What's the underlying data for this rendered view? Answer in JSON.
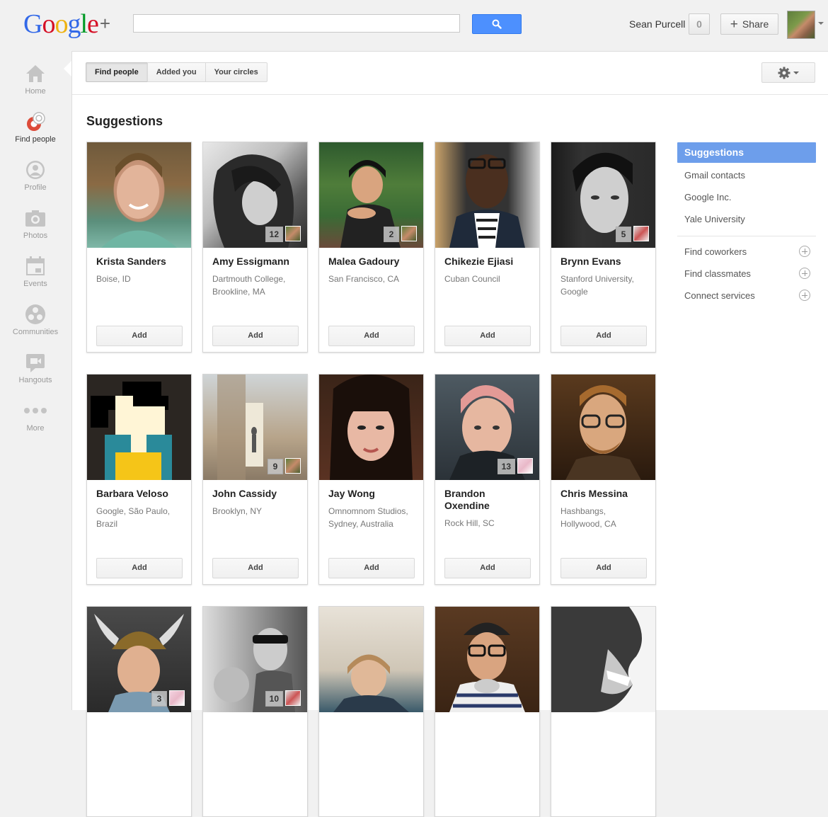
{
  "header": {
    "logo_letters": [
      "G",
      "o",
      "o",
      "g",
      "l",
      "e"
    ],
    "logo_plus": "+",
    "search_value": "",
    "username": "Sean Purcell",
    "notification_count": "0",
    "share_label": "Share"
  },
  "leftnav": {
    "items": [
      {
        "label": "Home",
        "icon": "home-icon"
      },
      {
        "label": "Find people",
        "icon": "find-people-icon",
        "active": true
      },
      {
        "label": "Profile",
        "icon": "profile-icon"
      },
      {
        "label": "Photos",
        "icon": "camera-icon"
      },
      {
        "label": "Events",
        "icon": "calendar-icon"
      },
      {
        "label": "Communities",
        "icon": "communities-icon"
      },
      {
        "label": "Hangouts",
        "icon": "hangouts-icon"
      },
      {
        "label": "More",
        "icon": "more-dots-icon"
      }
    ]
  },
  "tabs": [
    {
      "label": "Find people",
      "selected": true
    },
    {
      "label": "Added you"
    },
    {
      "label": "Your circles"
    }
  ],
  "main": {
    "title": "Suggestions",
    "add_label": "Add",
    "cards": [
      {
        "name": "Krista Sanders",
        "meta": [
          "Boise, ID"
        ],
        "badge": ""
      },
      {
        "name": "Amy Essigmann",
        "meta": [
          "Dartmouth College,",
          "Brookline, MA"
        ],
        "badge": "12"
      },
      {
        "name": "Malea Gadoury",
        "meta": [
          "San Francisco, CA"
        ],
        "badge": "2"
      },
      {
        "name": "Chikezie Ejiasi",
        "meta": [
          "Cuban Council"
        ],
        "badge": ""
      },
      {
        "name": "Brynn Evans",
        "meta": [
          "Stanford University,",
          "Google"
        ],
        "badge": "5"
      },
      {
        "name": "Barbara Veloso",
        "meta": [
          "Google, São Paulo,",
          "Brazil"
        ],
        "badge": ""
      },
      {
        "name": "John Cassidy",
        "meta": [
          "Brooklyn, NY"
        ],
        "badge": "9"
      },
      {
        "name": "Jay Wong",
        "meta": [
          "Omnomnom Studios,",
          "Sydney, Australia"
        ],
        "badge": ""
      },
      {
        "name": "Brandon Oxendine",
        "meta": [
          "Rock Hill, SC"
        ],
        "badge": "13"
      },
      {
        "name": "Chris Messina",
        "meta": [
          "Hashbangs,",
          "Hollywood, CA"
        ],
        "badge": ""
      },
      {
        "name": "",
        "meta": [],
        "badge": "3"
      },
      {
        "name": "",
        "meta": [],
        "badge": "10"
      },
      {
        "name": "",
        "meta": [],
        "badge": ""
      },
      {
        "name": "",
        "meta": [],
        "badge": ""
      },
      {
        "name": "",
        "meta": [],
        "badge": ""
      }
    ]
  },
  "rightpanel": {
    "filters": [
      {
        "label": "Suggestions",
        "selected": true
      },
      {
        "label": "Gmail contacts"
      },
      {
        "label": "Google Inc."
      },
      {
        "label": "Yale University"
      }
    ],
    "actions": [
      {
        "label": "Find coworkers"
      },
      {
        "label": "Find classmates"
      },
      {
        "label": "Connect services"
      }
    ]
  },
  "colors": {
    "accent_blue": "#4d90fe",
    "selected_filter": "#6d9eeb"
  }
}
